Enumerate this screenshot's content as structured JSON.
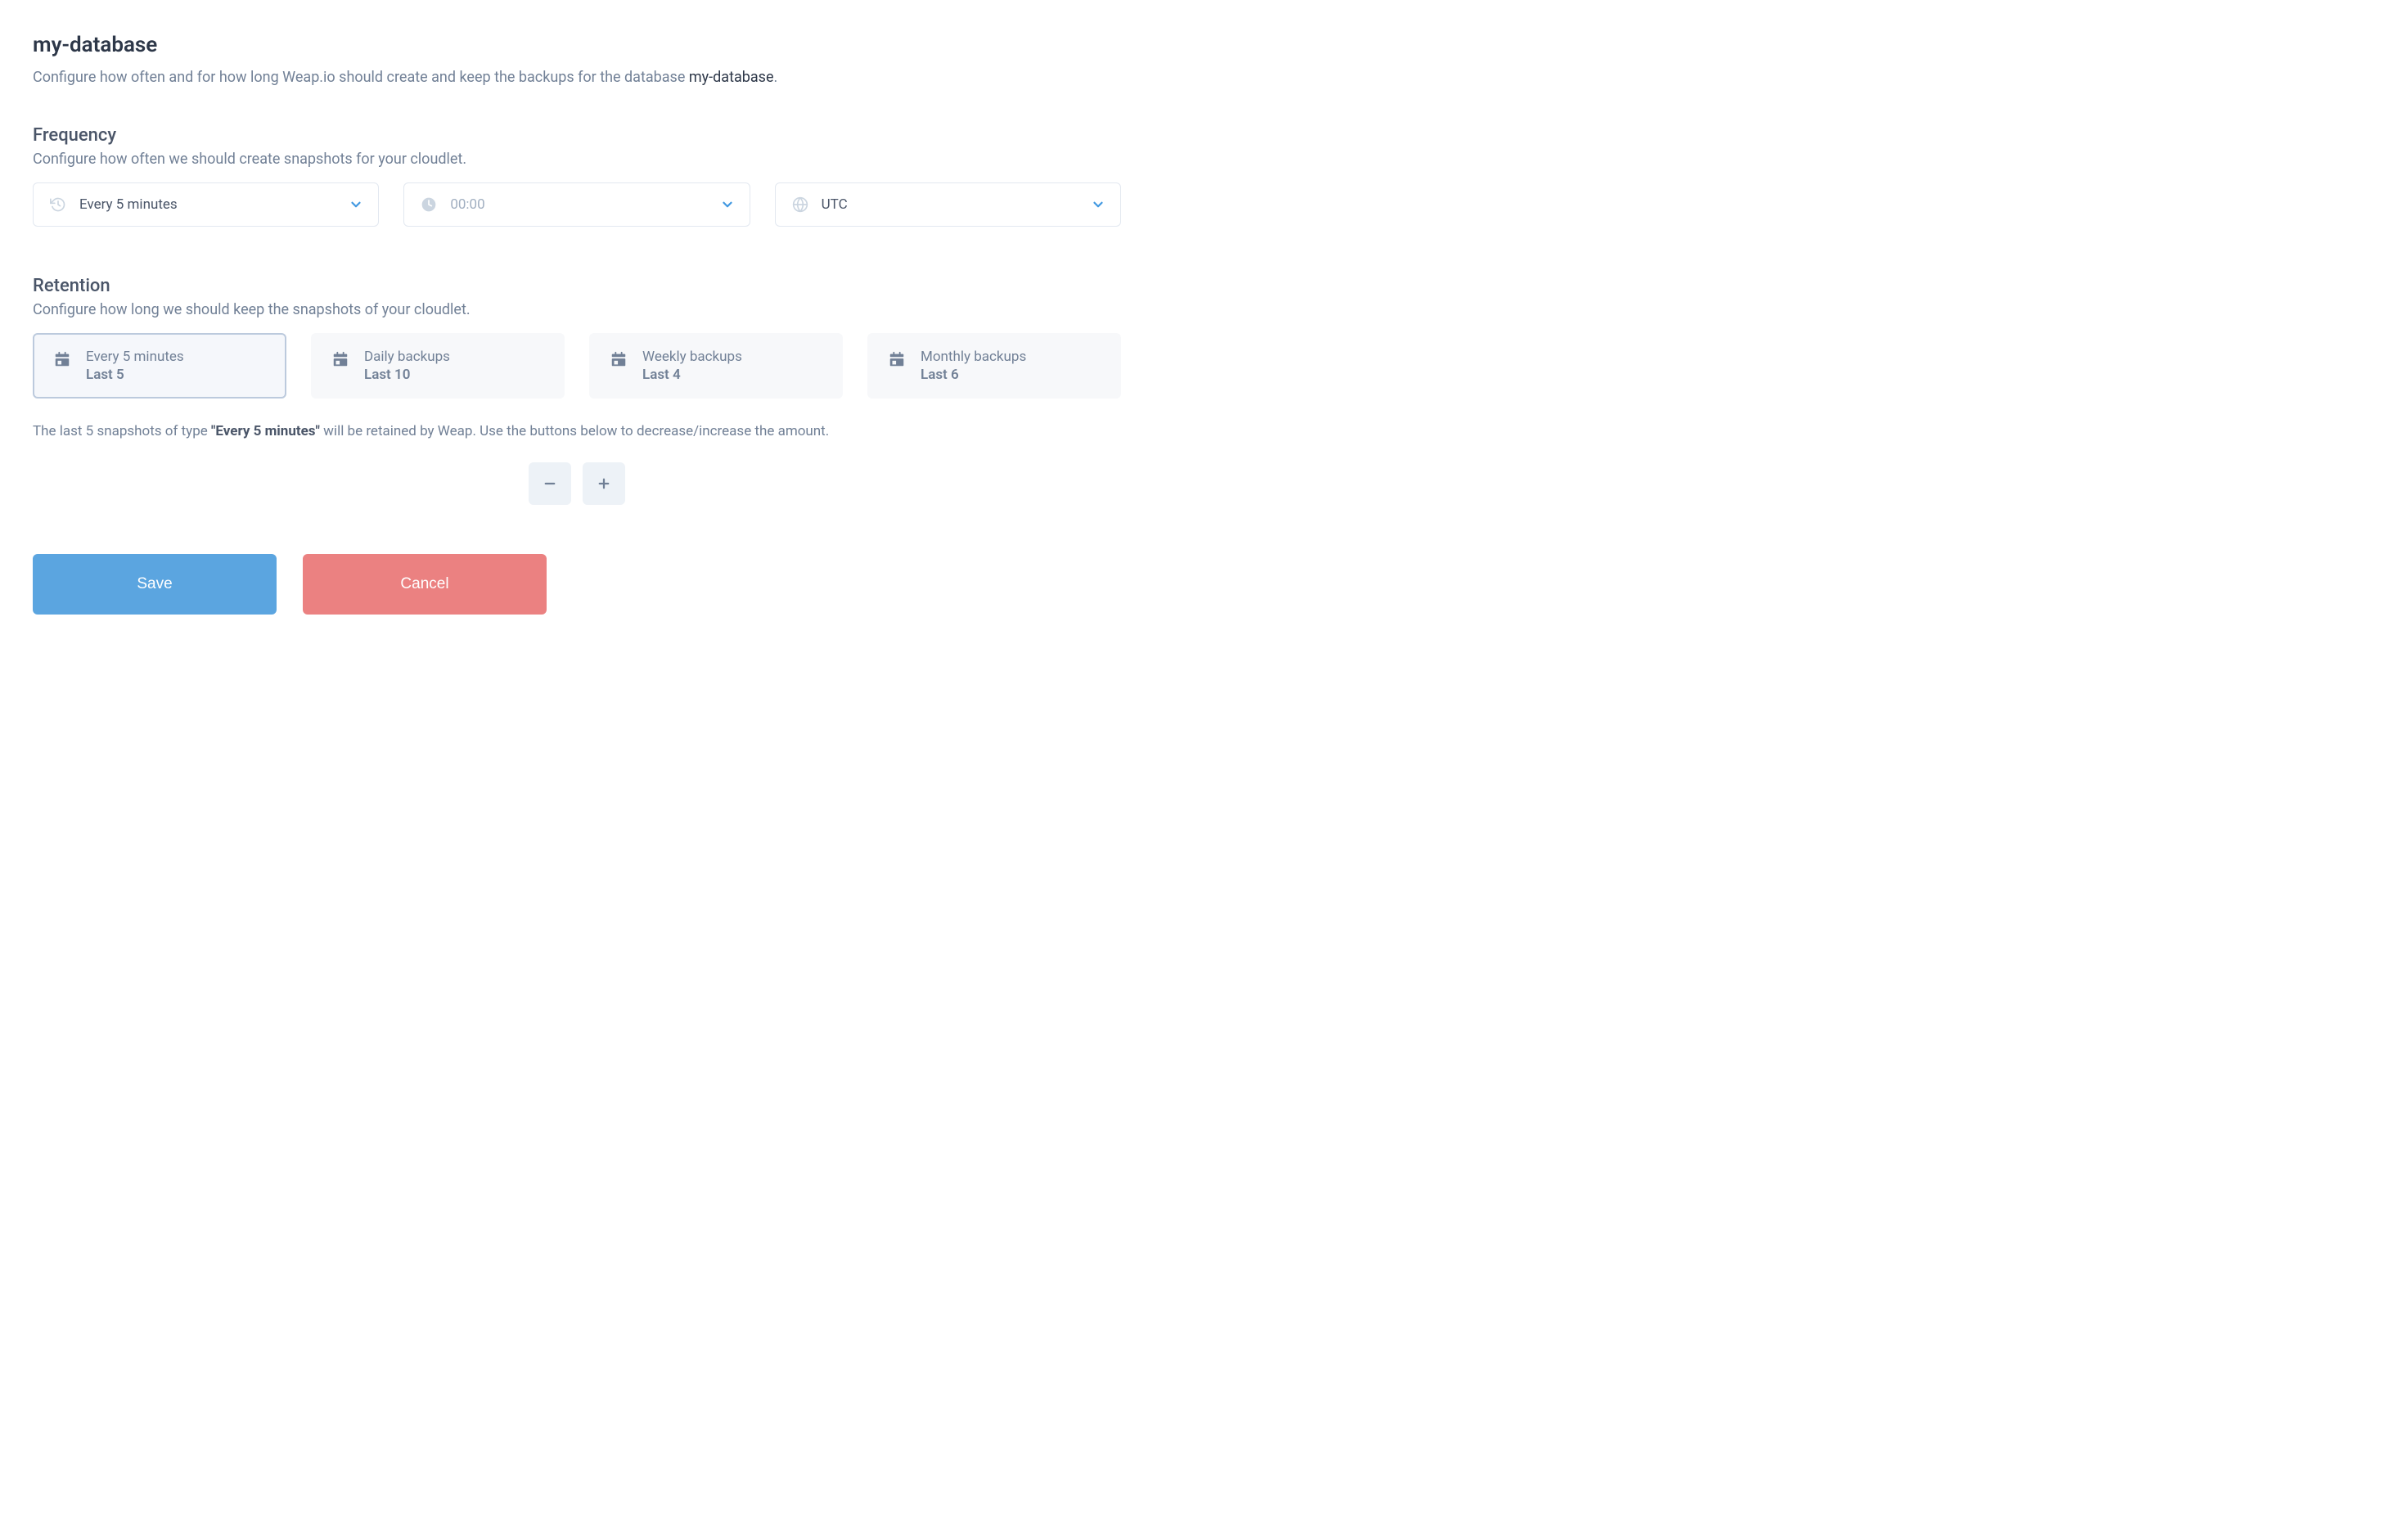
{
  "page": {
    "title": "my-database",
    "description_prefix": "Configure how often and for how long Weap.io should create and keep the backups for the database ",
    "description_strong": "my-database",
    "description_suffix": "."
  },
  "frequency": {
    "title": "Frequency",
    "description": "Configure how often we should create snapshots for your cloudlet.",
    "interval": "Every 5 minutes",
    "time": "00:00",
    "timezone": "UTC"
  },
  "retention": {
    "title": "Retention",
    "description": "Configure how long we should keep the snapshots of your cloudlet.",
    "cards": [
      {
        "title": "Every 5 minutes",
        "sub": "Last 5",
        "active": true
      },
      {
        "title": "Daily backups",
        "sub": "Last 10",
        "active": false
      },
      {
        "title": "Weekly backups",
        "sub": "Last 4",
        "active": false
      },
      {
        "title": "Monthly backups",
        "sub": "Last 6",
        "active": false
      }
    ],
    "info_prefix": "The last 5 snapshots of type ",
    "info_strong": "\"Every 5 minutes\"",
    "info_suffix": " will be retained by Weap. Use the buttons below to decrease/increase the amount."
  },
  "actions": {
    "save": "Save",
    "cancel": "Cancel"
  }
}
